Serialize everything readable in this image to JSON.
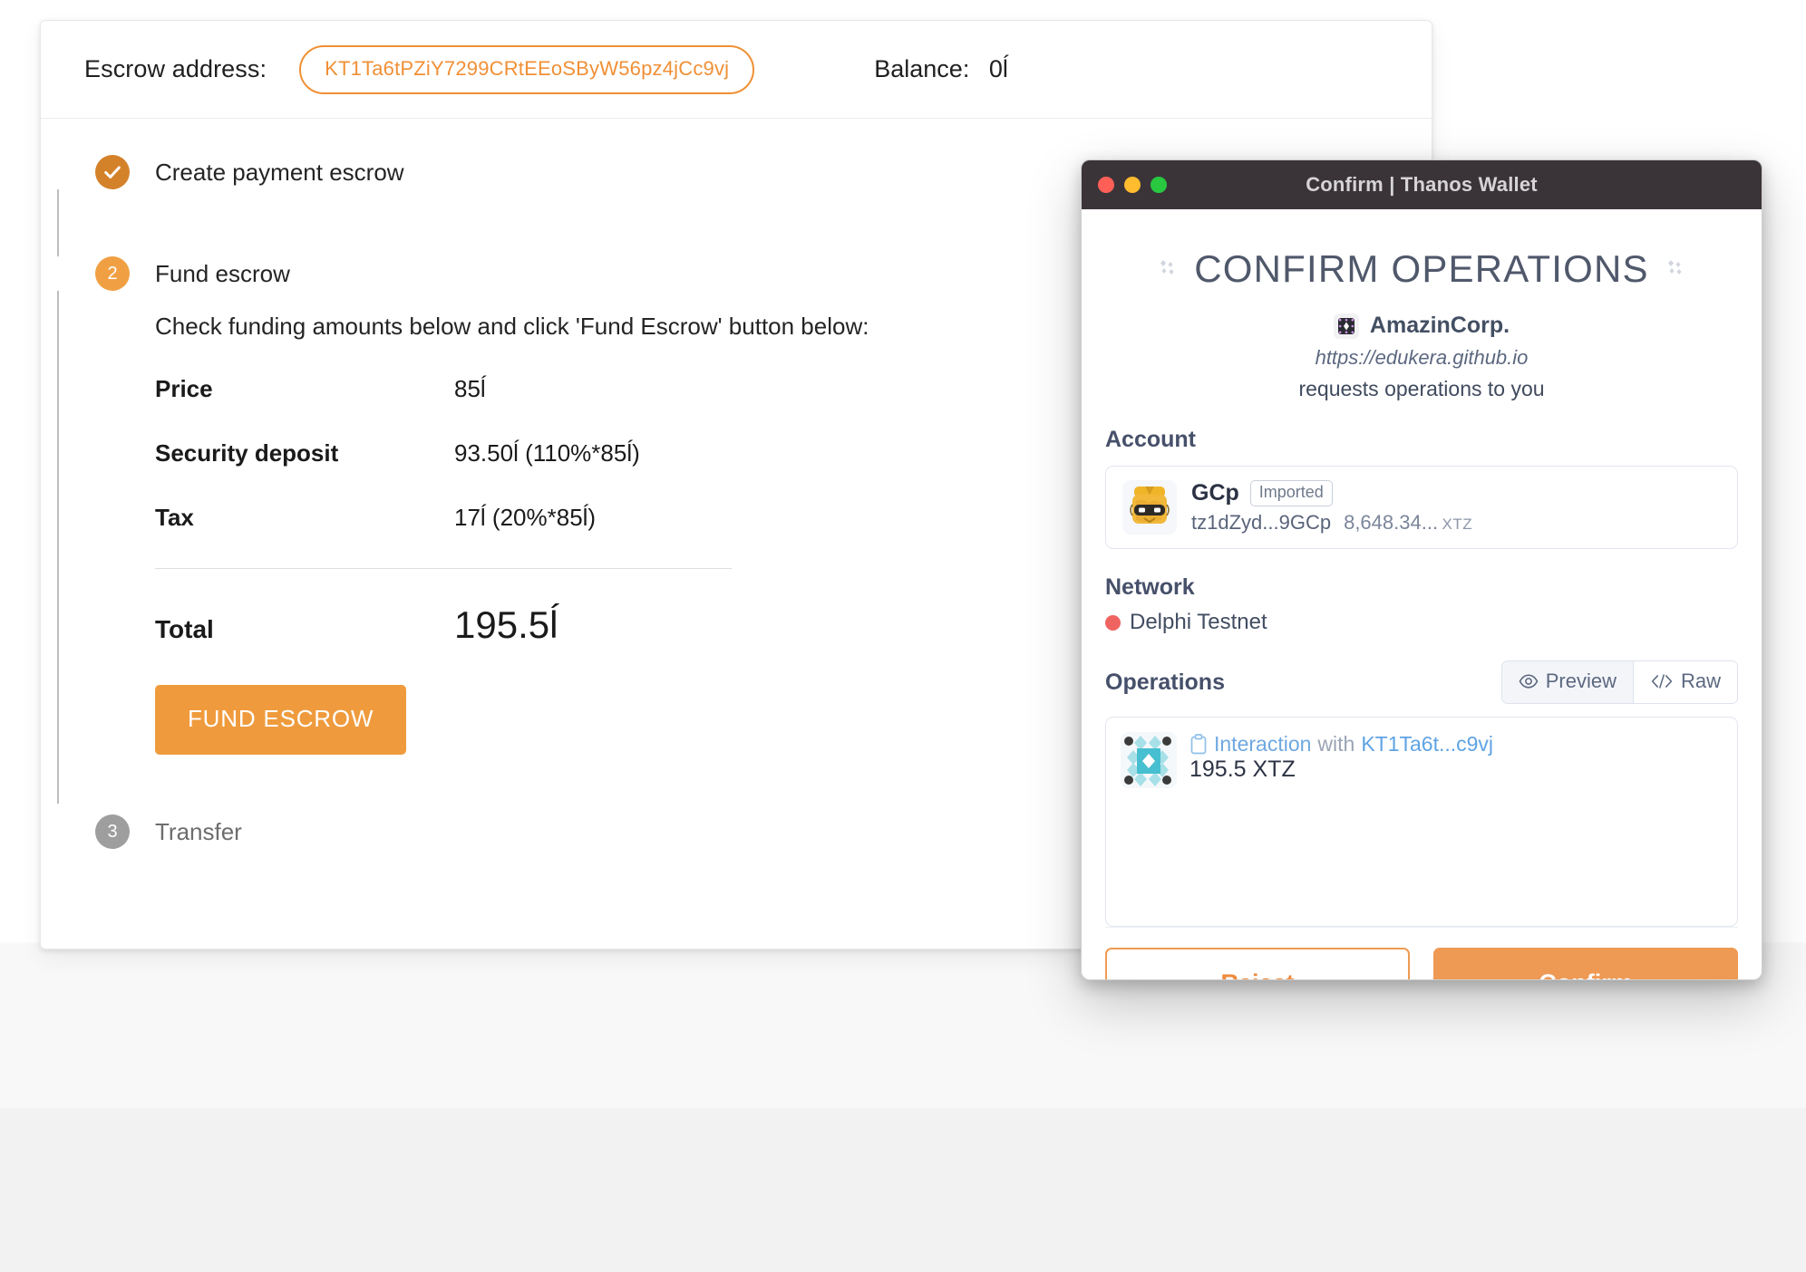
{
  "dapp": {
    "header": {
      "escrow_label": "Escrow address:",
      "escrow_address": "KT1Ta6tPZiY7299CRtEEoSByW56pz4jCc9vj",
      "balance_label": "Balance:",
      "balance_value": "0ĺ"
    },
    "steps": [
      {
        "num": "1",
        "label": "Create payment escrow",
        "state": "done"
      },
      {
        "num": "2",
        "label": "Fund escrow",
        "state": "active"
      },
      {
        "num": "3",
        "label": "Transfer",
        "state": "pending"
      }
    ],
    "fund": {
      "intro": "Check funding amounts below and click 'Fund Escrow' button below:",
      "rows": [
        {
          "key": "Price",
          "value": "85ĺ"
        },
        {
          "key": "Security deposit",
          "value": "93.50ĺ (110%*85ĺ)"
        },
        {
          "key": "Tax",
          "value": "17ĺ (20%*85ĺ)"
        }
      ],
      "total_key": "Total",
      "total_value": "195.5ĺ",
      "button_label": "FUND ESCROW"
    }
  },
  "wallet": {
    "window_title": "Confirm | Thanos Wallet",
    "heading": "CONFIRM OPERATIONS",
    "deco_left": "⁙",
    "deco_right": "⁙",
    "dapp_name": "AmazinCorp.",
    "dapp_url": "https://edukera.github.io",
    "request_text": "requests operations to you",
    "account": {
      "section_label": "Account",
      "name": "GCp",
      "badge": "Imported",
      "address": "tz1dZyd...9GCp",
      "balance": "8,648.34...",
      "currency": "XTZ"
    },
    "network": {
      "section_label": "Network",
      "name": "Delphi Testnet",
      "dot_color": "#ef6461"
    },
    "operations": {
      "section_label": "Operations",
      "toggle": [
        {
          "label": "Preview",
          "icon": "eye-icon",
          "active": true
        },
        {
          "label": "Raw",
          "icon": "code-icon",
          "active": false
        }
      ],
      "items": [
        {
          "kind": "Interaction",
          "with_label": "with",
          "target": "KT1Ta6t...c9vj",
          "amount": "195.5 XTZ"
        }
      ]
    },
    "footer": {
      "reject_label": "Reject",
      "confirm_label": "Confirm"
    }
  },
  "colors": {
    "accent_orange": "#ef9b3d",
    "address_orange": "#f09036",
    "titlebar": "#3a3439",
    "wallet_text": "#46506a"
  }
}
